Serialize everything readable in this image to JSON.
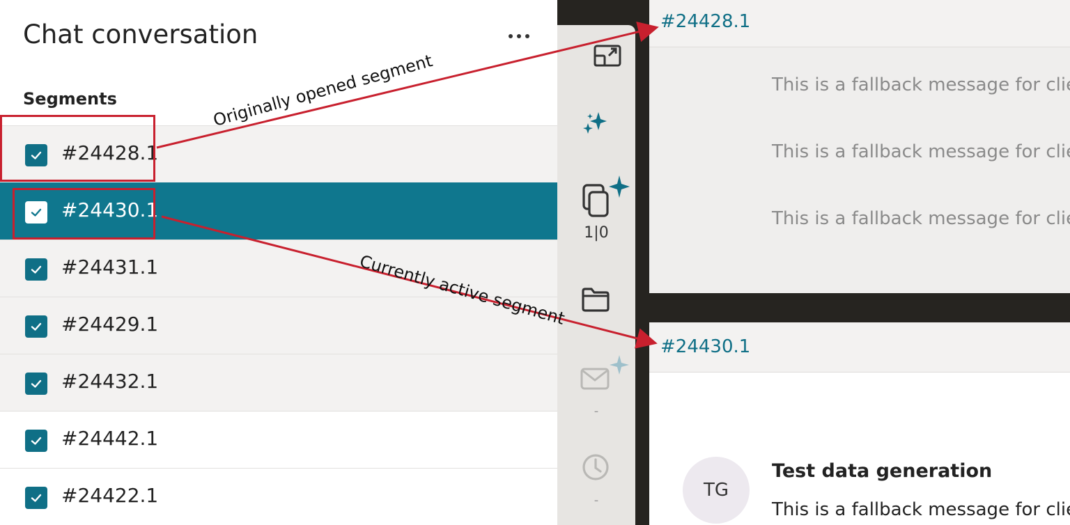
{
  "panel": {
    "title": "Chat conversation",
    "segments_label": "Segments",
    "segments": [
      {
        "id": "#24428.1",
        "checked": true,
        "bookmarked": true
      },
      {
        "id": "#24430.1",
        "checked": true,
        "active": true
      },
      {
        "id": "#24431.1",
        "checked": true
      },
      {
        "id": "#24429.1",
        "checked": true
      },
      {
        "id": "#24432.1",
        "checked": true
      },
      {
        "id": "#24442.1",
        "checked": true
      },
      {
        "id": "#24422.1",
        "checked": true
      }
    ]
  },
  "toolbar": {
    "counter": "1|0",
    "mail_count": "-",
    "history_count": "-",
    "icons": [
      "expand-icon",
      "sparkle-icon",
      "copy-icon",
      "folder-icon",
      "mail-icon",
      "clock-icon"
    ]
  },
  "pane1": {
    "segment_id": "#24428.1",
    "messages": [
      "This is a fallback message for clie",
      "This is a fallback message for clie",
      "This is a fallback message for clie"
    ]
  },
  "pane2": {
    "segment_id": "#24430.1",
    "avatar_initials": "TG",
    "author": "Test data generation",
    "message": "This is a fallback message for clie"
  },
  "annotations": {
    "original_label": "Originally opened segment",
    "current_label": "Currently active segment"
  },
  "colors": {
    "accent": "#0f778e",
    "annotation": "#c8202e",
    "dark_background": "#262420",
    "toolbar_background": "#e7e5e2"
  }
}
